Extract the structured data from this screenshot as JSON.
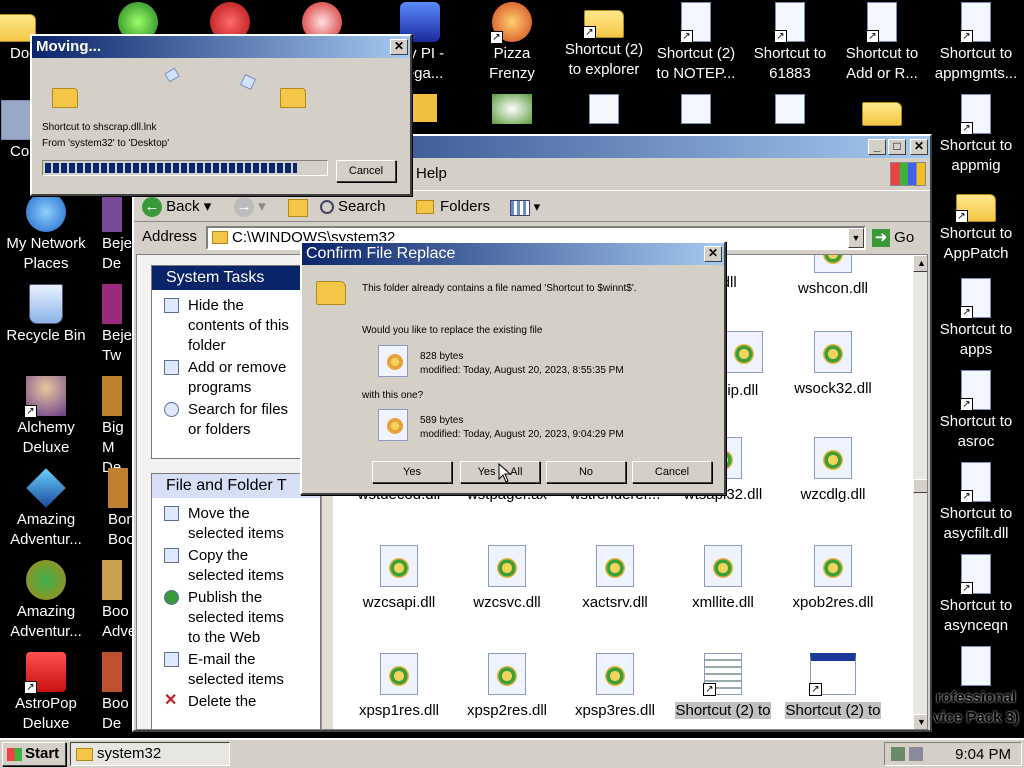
{
  "desktop": {
    "icons": [
      {
        "id": "doc",
        "label": "Doc"
      },
      {
        "id": "co",
        "label": "Co"
      },
      {
        "id": "my_network",
        "label": "My Network\nPlaces"
      },
      {
        "id": "recycle",
        "label": "Recycle Bin"
      },
      {
        "id": "alchemy",
        "label": "Alchemy\nDeluxe"
      },
      {
        "id": "amazing1",
        "label": "Amazing\nAdventur..."
      },
      {
        "id": "amazing2",
        "label": "Amazing\nAdventur..."
      },
      {
        "id": "astropop",
        "label": "AstroPop\nDeluxe"
      },
      {
        "id": "beje1",
        "label": "Beje\nDe"
      },
      {
        "id": "beje2",
        "label": "Beje\nTw"
      },
      {
        "id": "bigm",
        "label": "Big M\nDe"
      },
      {
        "id": "bon",
        "label": "Bon\nBoo"
      },
      {
        "id": "boo1",
        "label": "Boo\nAdve"
      },
      {
        "id": "boo2",
        "label": "Boo\nDe"
      },
      {
        "id": "mspi",
        "label": "ery PI -\nVega..."
      },
      {
        "id": "pizza",
        "label": "Pizza\nFrenzy"
      },
      {
        "id": "sc_explorer",
        "label": "Shortcut (2)\nto explorer"
      },
      {
        "id": "sc_notepad",
        "label": "Shortcut (2)\nto NOTEP..."
      },
      {
        "id": "sc_61883",
        "label": "Shortcut to\n61883"
      },
      {
        "id": "sc_addor",
        "label": "Shortcut to\nAdd or R..."
      },
      {
        "id": "sc_appmgmts",
        "label": "Shortcut to\nappmgmts..."
      },
      {
        "id": "sc_appmig",
        "label": "Shortcut to\nappmig"
      },
      {
        "id": "sc_apppatch",
        "label": "Shortcut to\nAppPatch"
      },
      {
        "id": "sc_apps",
        "label": "Shortcut to\napps"
      },
      {
        "id": "sc_asroc",
        "label": "Shortcut to\nasroc"
      },
      {
        "id": "sc_asycfilt",
        "label": "Shortcut to\nasycfilt.dll"
      },
      {
        "id": "sc_asyncequ",
        "label": "Shortcut to\nasynceqn"
      },
      {
        "id": "professional",
        "label": "rofessional\nvice Pack 3)"
      }
    ]
  },
  "moving_dialog": {
    "title": "Moving...",
    "file_line": "Shortcut to shscrap.dll.lnk",
    "from_line": "From 'system32' to 'Desktop'",
    "progress": 0.9,
    "cancel_label": "Cancel"
  },
  "explorer": {
    "title": "system32",
    "menu": {
      "help": "Help"
    },
    "toolbar": {
      "back": "Back",
      "search": "Search",
      "folders": "Folders"
    },
    "address_label": "Address",
    "address_value": "C:\\WINDOWS\\system32",
    "go_label": "Go",
    "system_tasks": {
      "heading": "System Tasks",
      "items": [
        "Hide the\ncontents of this\nfolder",
        "Add or remove\nprograms",
        "Search for files\nor folders"
      ]
    },
    "file_tasks": {
      "heading": "File and Folder T",
      "items": [
        "Move the\nselected items",
        "Copy the\nselected items",
        "Publish the\nselected items\nto the Web",
        "E-mail the\nselected items",
        "Delete the"
      ]
    },
    "files": {
      "row0": [
        "th.dll",
        "wshcon.dll"
      ],
      "row1": [
        "oip.dll",
        "wsock32.dll"
      ],
      "row2": [
        "wstdecod.dll",
        "wstpager.ax",
        "wstrenderer...",
        "wtsapi32.dll",
        "wzcdlg.dll"
      ],
      "row3": [
        "wzcsapi.dll",
        "wzcsvc.dll",
        "xactsrv.dll",
        "xmllite.dll",
        "xpob2res.dll"
      ],
      "row4": [
        "xpsp1res.dll",
        "xpsp2res.dll",
        "xpsp3res.dll",
        "Shortcut (2) to",
        "Shortcut (2) to"
      ]
    }
  },
  "confirm_dialog": {
    "title": "Confirm File Replace",
    "message": "This folder already contains a file named 'Shortcut to $winnt$'.",
    "question": "Would you like to replace the existing file",
    "existing": {
      "size": "828 bytes",
      "modified": "modified: Today, August 20, 2023, 8:55:35 PM"
    },
    "with_this": "with this one?",
    "new": {
      "size": "589 bytes",
      "modified": "modified: Today, August 20, 2023, 9:04:29 PM"
    },
    "buttons": {
      "yes": "Yes",
      "yes_all": "Yes to All",
      "no": "No",
      "cancel": "Cancel"
    }
  },
  "taskbar": {
    "start_label": "Start",
    "task_label": "system32",
    "clock": "9:04 PM"
  },
  "colors": {
    "titlebar": "#0a246a",
    "face": "#d4d0c8",
    "progress": "#0a246a"
  }
}
